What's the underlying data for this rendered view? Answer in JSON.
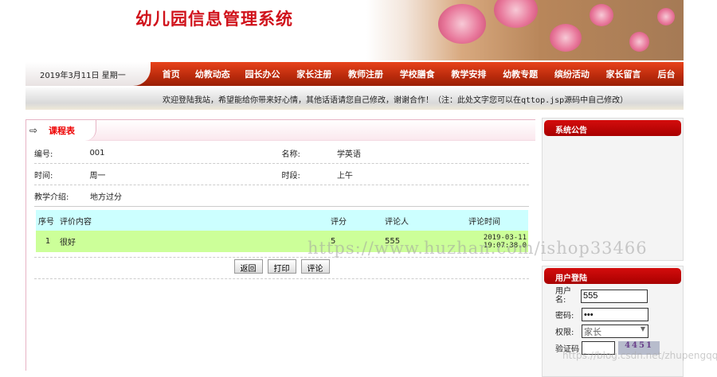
{
  "header": {
    "title": "幼儿园信息管理系统"
  },
  "nav": {
    "date": "2019年3月11日  星期一",
    "items": [
      "首页",
      "幼教动态",
      "园长办公",
      "家长注册",
      "教师注册",
      "学校膳食",
      "教学安排",
      "幼教专题",
      "缤纷活动",
      "家长留言",
      "后台"
    ]
  },
  "welcome": "欢迎登陆我站，希望能给你带来好心情，其他话语请您自己修改，谢谢合作！（注：此处文字您可以在qttop.jsp源码中自己修改）",
  "panel": {
    "title": "课程表",
    "fields": {
      "id_label": "编号:",
      "id": "001",
      "name_label": "名称:",
      "name": "学英语",
      "time_label": "时间:",
      "time": "周一",
      "period_label": "时段:",
      "period": "上午",
      "intro_label": "教学介绍:",
      "intro": "地方过分"
    },
    "table": {
      "headers": [
        "序号",
        "评价内容",
        "评分",
        "评论人",
        "评论时间"
      ],
      "rows": [
        [
          "1",
          "很好",
          "5",
          "555",
          "2019-03-11 19:07:38.0"
        ]
      ]
    },
    "buttons": {
      "back": "返回",
      "print": "打印",
      "comment": "评论"
    }
  },
  "sidebar": {
    "notice_title": "系统公告",
    "login_title": "用户登陆",
    "username_label": "用户名:",
    "username": "555",
    "password_label": "密码:",
    "password": "•••",
    "role_label": "权限:",
    "role": "家长",
    "captcha_label": "验证码",
    "captcha": "4451"
  },
  "watermarks": [
    "https://www.huzhan.com/ishop33466",
    "https://blog.csdn.net/zhupengqq"
  ]
}
